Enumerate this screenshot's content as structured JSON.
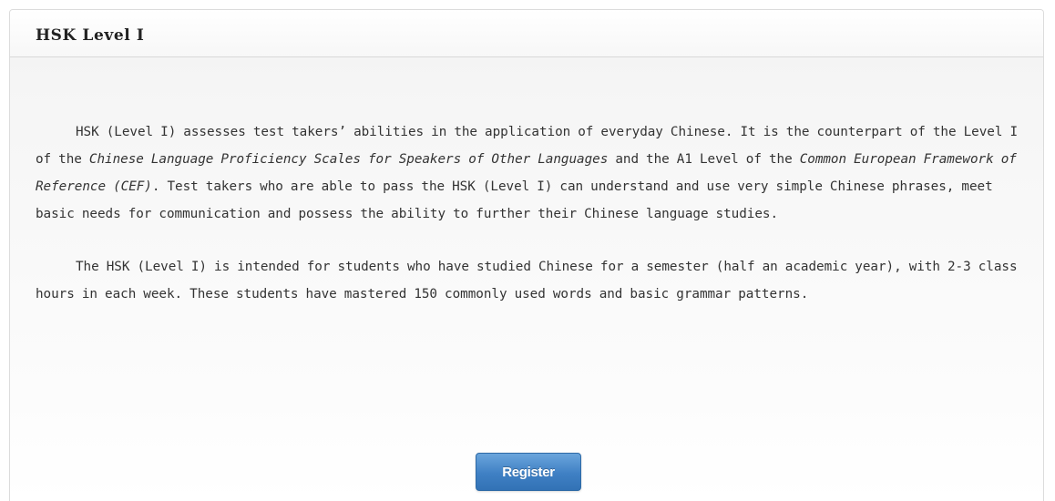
{
  "panel": {
    "title": "HSK Level Ⅰ"
  },
  "content": {
    "paragraph_1": [
      {
        "text": "HSK (Level I) assesses test takers’  abilities in the application of everyday Chinese. It is the counterpart of the Level I of the ",
        "italic": false
      },
      {
        "text": "Chinese Language Proficiency Scales for Speakers of Other Languages",
        "italic": true
      },
      {
        "text": " and the A1 Level of the ",
        "italic": false
      },
      {
        "text": "Common European Framework of Reference (CEF)",
        "italic": true
      },
      {
        "text": ". Test takers who are able to pass the HSK (Level I) can understand and use very simple Chinese phrases, meet basic needs for communication and possess the ability to further their Chinese language studies.",
        "italic": false
      }
    ],
    "paragraph_2": "The HSK (Level I) is intended for students who have studied Chinese for a semester (half an academic year), with 2-3 class hours in each week. These students have mastered 150 commonly used words and basic grammar patterns."
  },
  "actions": {
    "register_label": "Register"
  },
  "colors": {
    "button_accent": "#3f80c4",
    "text": "#333333"
  }
}
